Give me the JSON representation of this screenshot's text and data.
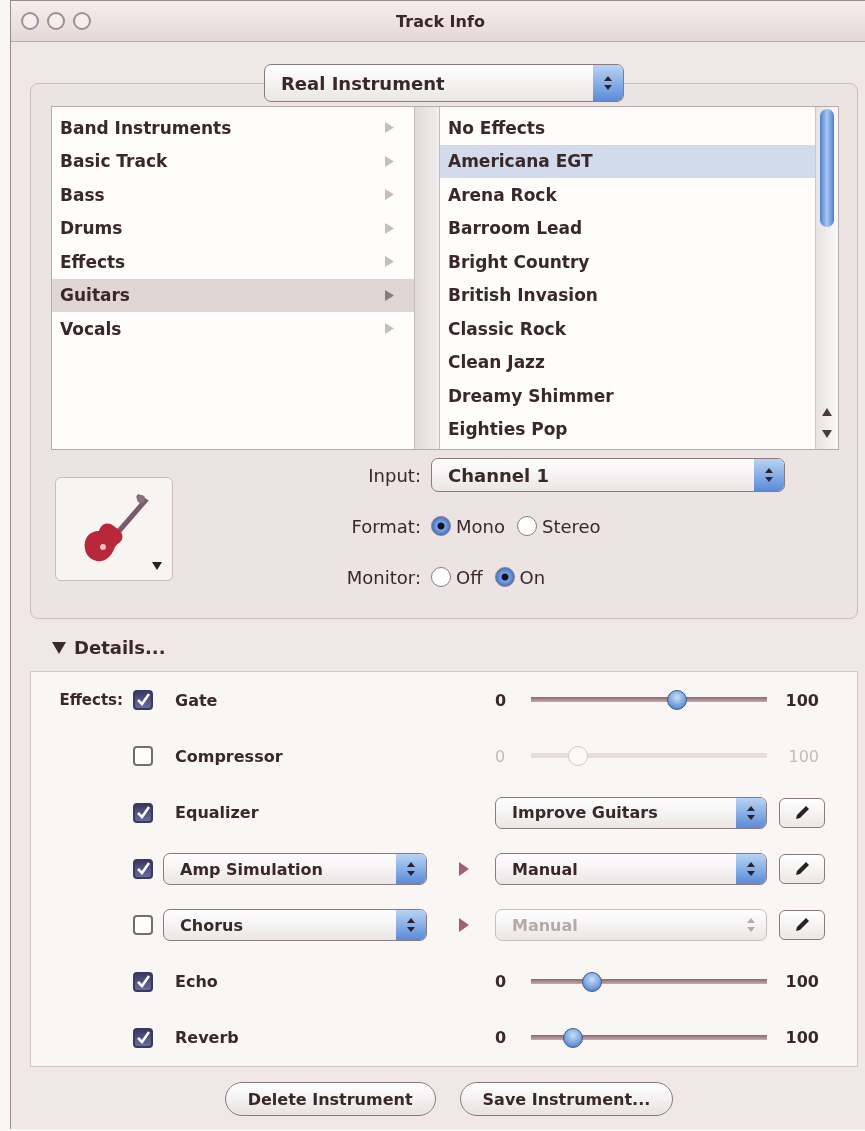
{
  "window": {
    "title": "Track Info"
  },
  "track_type": {
    "value": "Real Instrument"
  },
  "categories": [
    {
      "label": "Band Instruments",
      "selected": false
    },
    {
      "label": "Basic Track",
      "selected": false
    },
    {
      "label": "Bass",
      "selected": false
    },
    {
      "label": "Drums",
      "selected": false
    },
    {
      "label": "Effects",
      "selected": false
    },
    {
      "label": "Guitars",
      "selected": true
    },
    {
      "label": "Vocals",
      "selected": false
    }
  ],
  "presets": [
    {
      "label": "No Effects",
      "selected": false
    },
    {
      "label": "Americana EGT",
      "selected": true
    },
    {
      "label": "Arena Rock",
      "selected": false
    },
    {
      "label": "Barroom Lead",
      "selected": false
    },
    {
      "label": "Bright Country",
      "selected": false
    },
    {
      "label": "British Invasion",
      "selected": false
    },
    {
      "label": "Classic Rock",
      "selected": false
    },
    {
      "label": "Clean Jazz",
      "selected": false
    },
    {
      "label": "Dreamy Shimmer",
      "selected": false
    },
    {
      "label": "Eighties Pop",
      "selected": false
    }
  ],
  "input": {
    "label": "Input:",
    "value": "Channel 1"
  },
  "format": {
    "label": "Format:",
    "options": [
      {
        "label": "Mono",
        "selected": true
      },
      {
        "label": "Stereo",
        "selected": false
      }
    ]
  },
  "monitor": {
    "label": "Monitor:",
    "options": [
      {
        "label": "Off",
        "selected": false
      },
      {
        "label": "On",
        "selected": true
      }
    ]
  },
  "details": {
    "label": "Details...",
    "expanded": true
  },
  "effects": {
    "label": "Effects:",
    "rows": [
      {
        "kind": "slider",
        "name": "Gate",
        "checked": true,
        "min": "0",
        "max": "100",
        "level": 0.62
      },
      {
        "kind": "slider",
        "name": "Compressor",
        "checked": false,
        "min": "0",
        "max": "100",
        "level": 0.2
      },
      {
        "kind": "preset",
        "name": "Equalizer",
        "checked": true,
        "preset": "Improve Guitars"
      },
      {
        "kind": "chain",
        "name": "Amp Simulation",
        "checked": true,
        "preset": "Manual"
      },
      {
        "kind": "chain",
        "name": "Chorus",
        "checked": false,
        "preset": "Manual"
      },
      {
        "kind": "slider",
        "name": "Echo",
        "checked": true,
        "min": "0",
        "max": "100",
        "level": 0.26
      },
      {
        "kind": "slider",
        "name": "Reverb",
        "checked": true,
        "min": "0",
        "max": "100",
        "level": 0.18
      }
    ]
  },
  "buttons": [
    "Delete Instrument",
    "Save Instrument..."
  ]
}
